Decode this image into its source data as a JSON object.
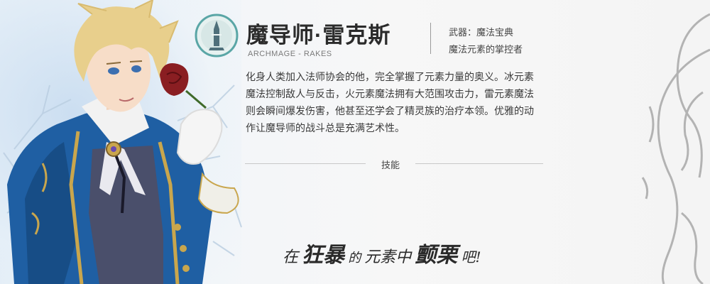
{
  "hero": {
    "title": "魔导师·雷克斯",
    "subtitle": "ARCHMAGE - RAKES",
    "weapon": "武器：魔法宝典",
    "role": "魔法元素的掌控者",
    "description": "化身人类加入法师协会的他，完全掌握了元素力量的奥义。冰元素魔法控制敌人与反击，火元素魔法拥有大范围攻击力，雷元素魔法则会瞬间爆发伤害，他甚至还学会了精灵族的治疗本领。优雅的动作让魔导师的战斗总是充满艺术性。",
    "skills_label": "技能"
  },
  "slogan": {
    "part1": "在",
    "part2": "狂暴",
    "part3": "的",
    "part4": "元素中",
    "part5": "颤栗",
    "part6": "吧!"
  },
  "colors": {
    "coat": "#1f5fa3",
    "coat_dark": "#123f74",
    "hair": "#e8cf8c",
    "rose": "#8a1e22",
    "gold_trim": "#c9a64d",
    "vest": "#4a4f6b",
    "emblem_ring": "#5aa6a6",
    "title_text": "#2b2b2b"
  },
  "icons": {
    "emblem": "tower-emblem-icon",
    "character": "archmage-character-portrait",
    "vines": "silver-vine-decoration"
  }
}
